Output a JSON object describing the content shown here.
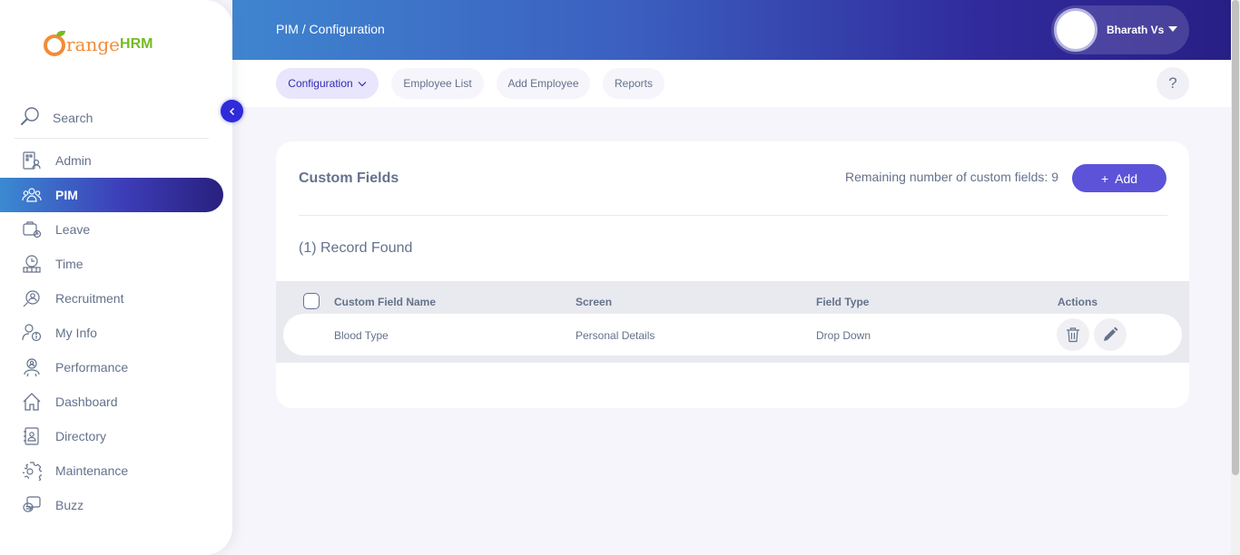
{
  "brand": {
    "logo_text": "range",
    "logo_suffix": "HRM",
    "logo_primary_color": "#f28c38",
    "logo_secondary_color": "#76bc21"
  },
  "sidebar": {
    "search_label": "Search",
    "items": [
      {
        "label": "Admin",
        "icon": "admin-icon"
      },
      {
        "label": "PIM",
        "icon": "pim-icon",
        "active": true
      },
      {
        "label": "Leave",
        "icon": "leave-icon"
      },
      {
        "label": "Time",
        "icon": "time-icon"
      },
      {
        "label": "Recruitment",
        "icon": "recruitment-icon"
      },
      {
        "label": "My Info",
        "icon": "my-info-icon"
      },
      {
        "label": "Performance",
        "icon": "performance-icon"
      },
      {
        "label": "Dashboard",
        "icon": "dashboard-icon"
      },
      {
        "label": "Directory",
        "icon": "directory-icon"
      },
      {
        "label": "Maintenance",
        "icon": "maintenance-icon"
      },
      {
        "label": "Buzz",
        "icon": "buzz-icon"
      }
    ]
  },
  "header": {
    "breadcrumb": "PIM / Configuration",
    "user_name": "Bharath Vs"
  },
  "subnav": {
    "tabs": [
      {
        "label": "Configuration",
        "active": true
      },
      {
        "label": "Employee List"
      },
      {
        "label": "Add Employee"
      },
      {
        "label": "Reports"
      }
    ],
    "help_label": "?"
  },
  "main": {
    "title": "Custom Fields",
    "remaining_text": "Remaining number of custom fields: 9",
    "add_button": "Add",
    "records_found": "(1) Record Found",
    "table": {
      "columns": [
        "Custom Field Name",
        "Screen",
        "Field Type",
        "Actions"
      ],
      "rows": [
        {
          "name": "Blood Type",
          "screen": "Personal Details",
          "field_type": "Drop Down"
        }
      ]
    }
  },
  "colors": {
    "accent": "#5c53d9",
    "active_gradient_start": "#3b8ad1",
    "active_gradient_end": "#28207e",
    "text": "#64728c"
  }
}
